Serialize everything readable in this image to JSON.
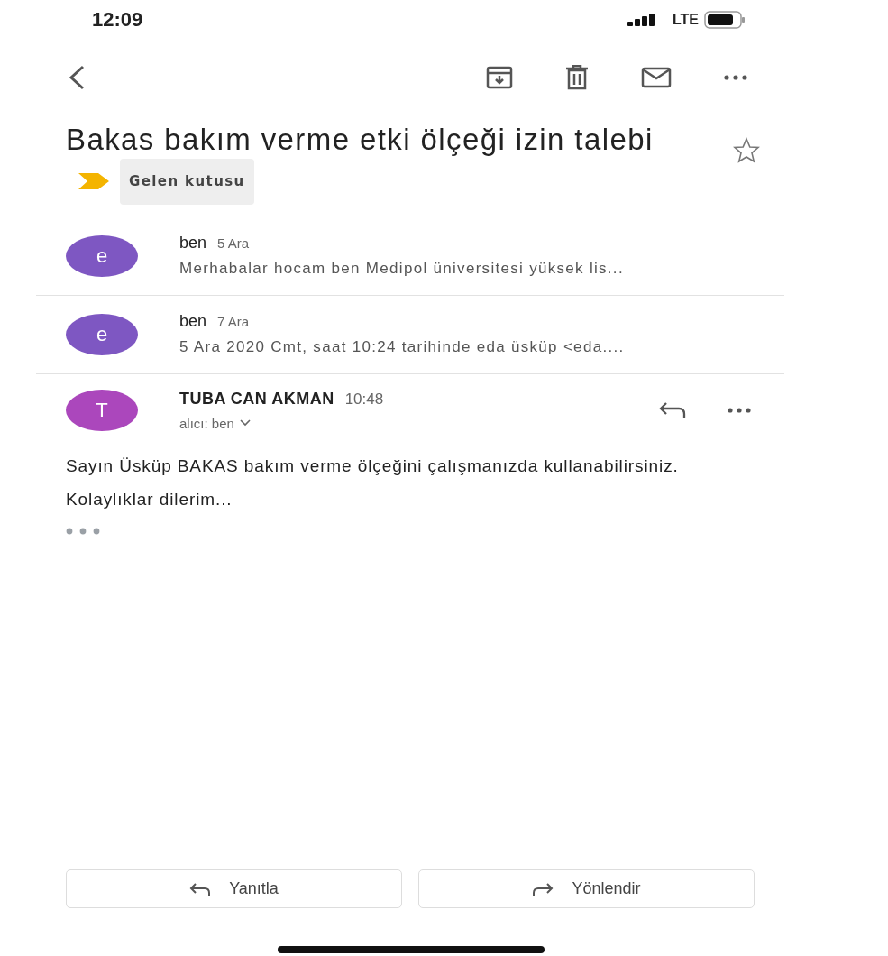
{
  "status_bar": {
    "time": "12:09",
    "network": "LTE"
  },
  "subject": {
    "title": "Bakas bakım verme etki ölçeği izin talebi",
    "important": true,
    "label": "Gelen kutusu",
    "starred": false
  },
  "messages": [
    {
      "kind": "collapsed",
      "avatar": "e",
      "color": "#7e57c2",
      "sender": "ben",
      "date": "5 Ara",
      "snippet": "Merhabalar hocam ben Medipol üniversitesi yüksek lis..."
    },
    {
      "kind": "collapsed",
      "avatar": "e",
      "color": "#7e57c2",
      "sender": "ben",
      "date": "7 Ara",
      "snippet": "5 Ara 2020 Cmt, saat 10:24 tarihinde eda üsküp <eda...."
    },
    {
      "kind": "expanded",
      "avatar": "T",
      "color": "#ab47bc",
      "sender": "TUBA CAN AKMAN",
      "date": "10:48",
      "recipient": "alıcı: ben",
      "body": [
        "Sayın Üsküp BAKAS bakım verme ölçeğini çalışmanızda kullanabilirsiniz.",
        "Kolaylıklar dilerim..."
      ]
    }
  ],
  "actions": [
    "Yanıtla",
    "Yönlendir"
  ]
}
